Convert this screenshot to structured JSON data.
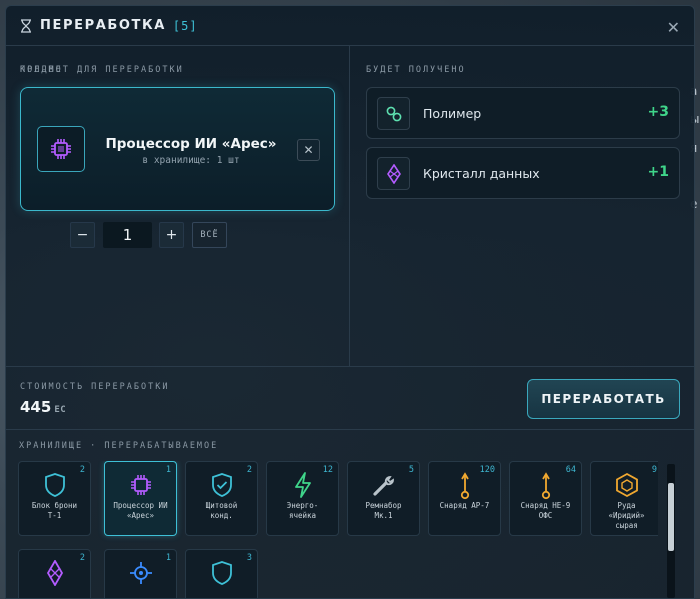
{
  "window": {
    "title": "ПЕРЕРАБОТКА",
    "count": "[5]"
  },
  "input": {
    "section_label": "ПРЕДМЕТ ДЛЯ ПЕРЕРАБОТКИ",
    "item_name": "Процессор ИИ «Арес»",
    "item_stock": "в хранилище: 1 шт",
    "icon": "chip-icon"
  },
  "quantity": {
    "label": "КОЛ-ВО",
    "minus": "−",
    "value": "1",
    "plus": "+",
    "all": "ВСЁ"
  },
  "output": {
    "section_label": "БУДЕТ ПОЛУЧЕНО",
    "items": [
      {
        "name": "Полимер",
        "qty": "+3",
        "icon": "polymer-icon"
      },
      {
        "name": "Кристалл данных",
        "qty": "+1",
        "icon": "crystal-icon"
      }
    ]
  },
  "cost": {
    "label": "СТОИМОСТЬ ПЕРЕРАБОТКИ",
    "value": "445",
    "unit": "ЕС"
  },
  "process_button": "ПЕРЕРАБОТАТЬ",
  "storage": {
    "label": "ХРАНИЛИЩЕ · ПЕРЕРАБАТЫВАЕМОЕ",
    "items": [
      {
        "name": "Блок брони\nТ-1",
        "count": "2",
        "icon": "shield-icon"
      },
      {
        "name": "Процессор ИИ\n«Арес»",
        "count": "1",
        "icon": "chip-icon",
        "selected": true
      },
      {
        "name": "Щитовой\nконд.",
        "count": "2",
        "icon": "shield-check-icon"
      },
      {
        "name": "Энерго-\nячейка",
        "count": "12",
        "icon": "lightning-icon"
      },
      {
        "name": "Ремнабор\nМк.1",
        "count": "5",
        "icon": "wrench-icon"
      },
      {
        "name": "Снаряд АР-7",
        "count": "120",
        "icon": "ammo-icon"
      },
      {
        "name": "Снаряд НЕ-9\nОФС",
        "count": "64",
        "icon": "ammo-icon"
      },
      {
        "name": "Руда\n«Иридий»\nсырая",
        "count": "9",
        "icon": "ore-icon"
      },
      {
        "name": "",
        "count": "2",
        "icon": "crystal-icon"
      },
      {
        "name": "",
        "count": "1",
        "icon": "scope-icon"
      },
      {
        "name": "",
        "count": "3",
        "icon": "shield-icon"
      }
    ]
  },
  "colors": {
    "accent": "#3ec0d6",
    "positive": "#3fd58a",
    "chip": "#b35cff",
    "ammo": "#f0a830"
  }
}
